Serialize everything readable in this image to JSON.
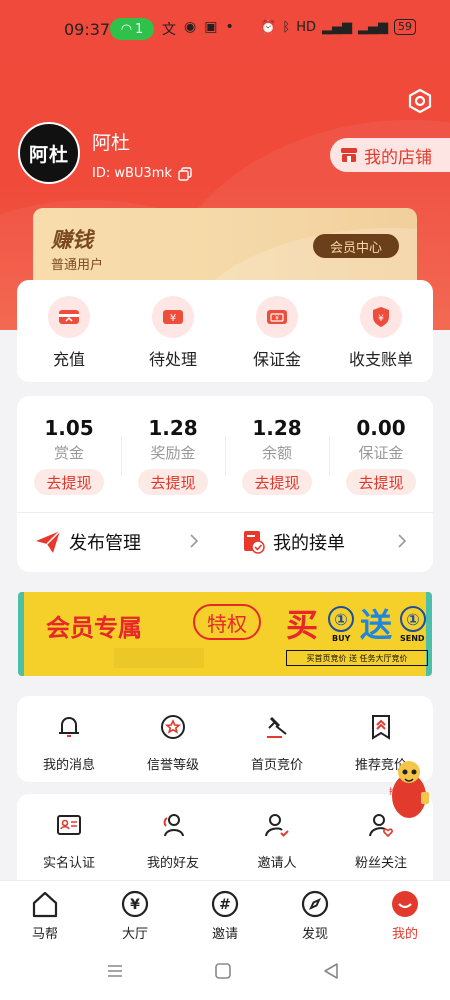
{
  "status_bar": {
    "time": "09:37",
    "wifi_count": "1",
    "battery": "59",
    "icons": [
      "translate-icon",
      "wechat-icon",
      "app-icon",
      "dot"
    ]
  },
  "profile": {
    "avatar_text": "阿杜",
    "name": "阿杜",
    "id_label": "ID: wBU3mk",
    "shop_button": "我的店铺"
  },
  "vip": {
    "title": "赚钱",
    "level": "普通用户",
    "center_button": "会员中心"
  },
  "actions": [
    {
      "label": "充值",
      "icon": "card-icon"
    },
    {
      "label": "待处理",
      "icon": "yuan-ticket-icon"
    },
    {
      "label": "保证金",
      "icon": "deposit-card-icon"
    },
    {
      "label": "收支账单",
      "icon": "shield-yuan-icon"
    }
  ],
  "balances": [
    {
      "value": "1.05",
      "label": "赏金",
      "action": "去提现"
    },
    {
      "value": "1.28",
      "label": "奖励金",
      "action": "去提现"
    },
    {
      "value": "1.28",
      "label": "余额",
      "action": "去提现"
    },
    {
      "value": "0.00",
      "label": "保证金",
      "action": "去提现"
    }
  ],
  "management": {
    "publish": "发布管理",
    "orders": "我的接单"
  },
  "banner": {
    "member": "会员专属",
    "special": "特权",
    "buy": "买",
    "one_a": "①",
    "buy_en": "BUY",
    "get": "送",
    "one_b": "①",
    "send_en": "SEND",
    "note": "买首页竞价 送 任务大厅竞价"
  },
  "grid_row1": [
    {
      "label": "我的消息",
      "icon": "bell-icon"
    },
    {
      "label": "信誉等级",
      "icon": "star-badge-icon"
    },
    {
      "label": "首页竞价",
      "icon": "gavel-icon"
    },
    {
      "label": "推荐竞价",
      "icon": "bookmark-chevron-icon"
    }
  ],
  "grid_row2": [
    {
      "label": "实名认证",
      "icon": "id-card-icon"
    },
    {
      "label": "我的好友",
      "icon": "friends-icon"
    },
    {
      "label": "邀请人",
      "icon": "person-check-icon"
    },
    {
      "label": "粉丝关注",
      "icon": "person-heart-icon"
    }
  ],
  "mascot_text": "抢红包了",
  "tabs": [
    {
      "label": "马帮",
      "icon": "house-icon"
    },
    {
      "label": "大厅",
      "icon": "yuan-circle-icon"
    },
    {
      "label": "邀请",
      "icon": "hash-icon"
    },
    {
      "label": "发现",
      "icon": "compass-icon"
    },
    {
      "label": "我的",
      "icon": "smile-icon",
      "active": true
    }
  ],
  "colors": {
    "primary": "#e23a2d",
    "hero": "#f04a3a",
    "gold": "#f5d9a8",
    "banner_yellow": "#f5d02a"
  }
}
